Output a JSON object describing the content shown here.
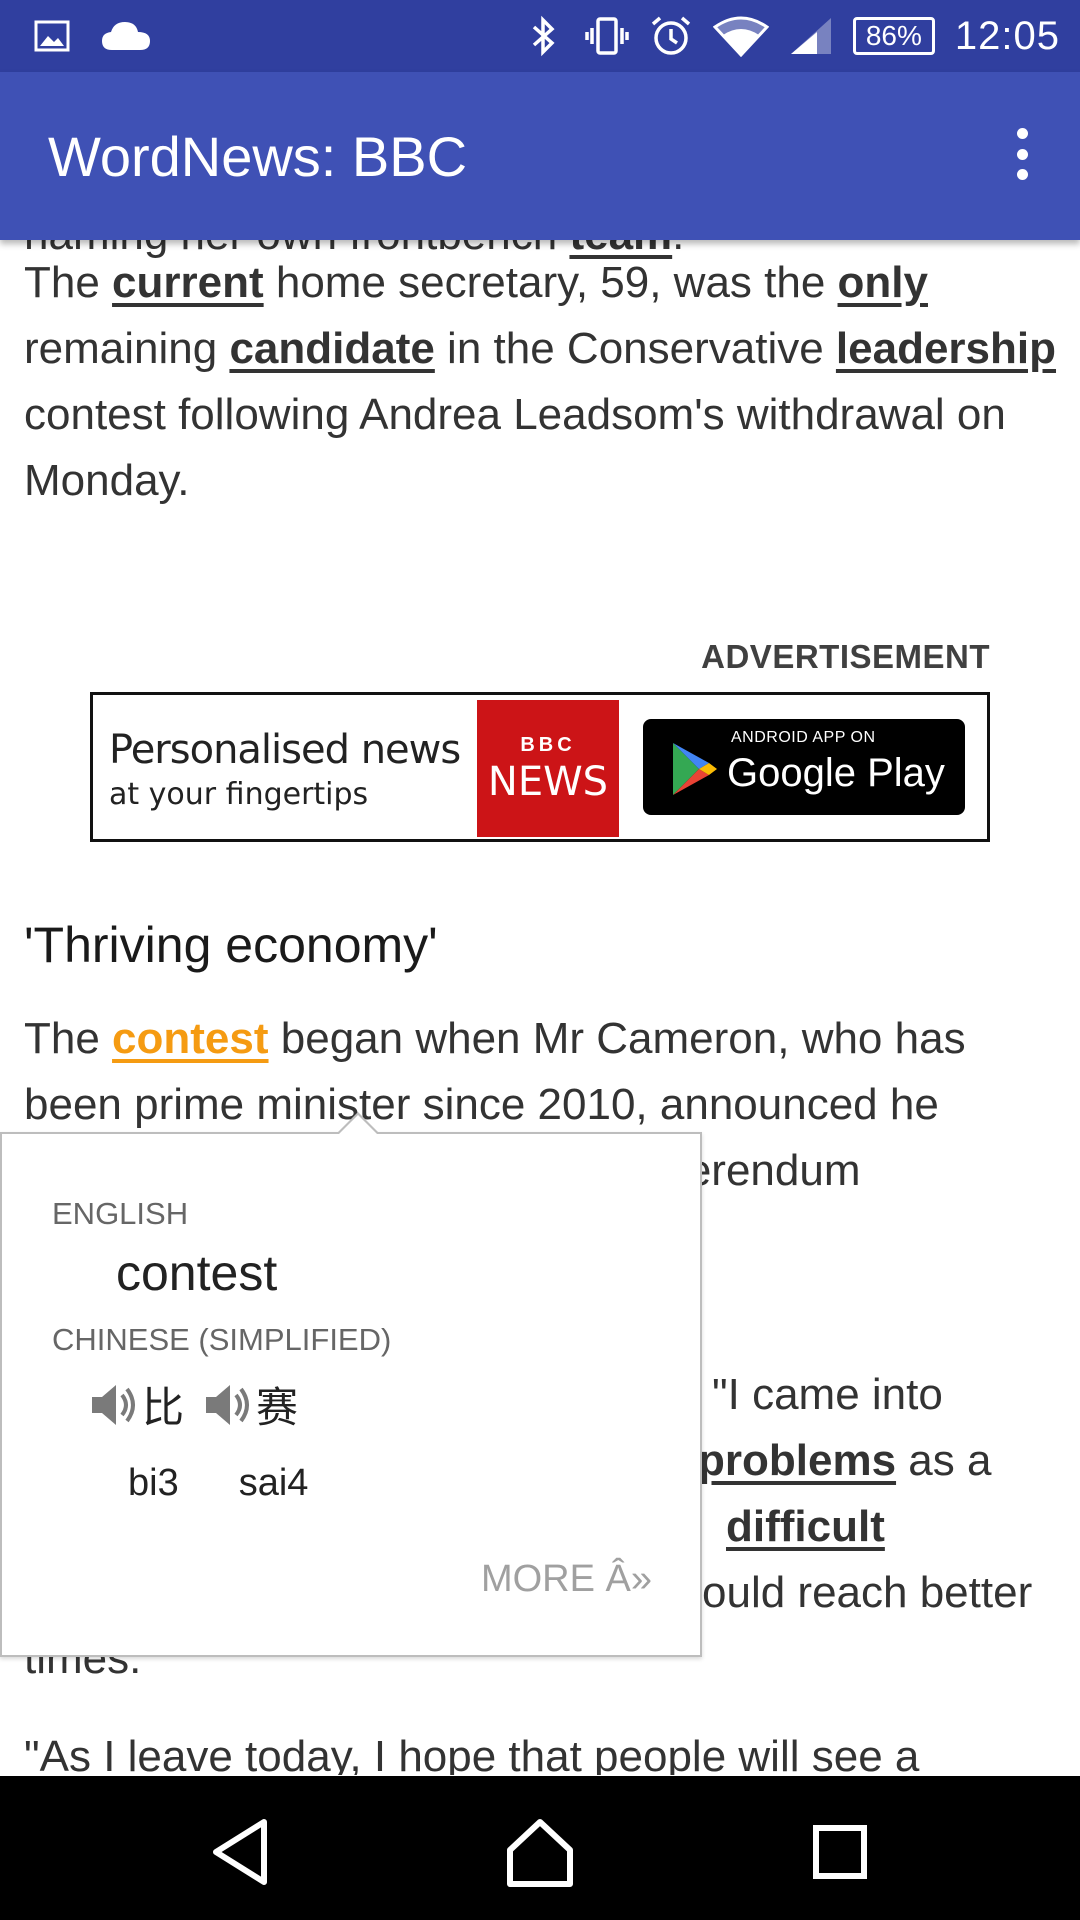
{
  "status_bar": {
    "icons_left": [
      "image-icon",
      "cloud-icon"
    ],
    "icons_right": [
      "bluetooth-icon",
      "vibrate-icon",
      "alarm-icon",
      "wifi-icon",
      "cellular-signal-icon"
    ],
    "battery": "86%",
    "time": "12:05"
  },
  "app_bar": {
    "title": "WordNews: BBC",
    "menu_icon": "overflow-menu-icon"
  },
  "article": {
    "top_cut_line": {
      "pre": "naming her own frontbench ",
      "kw": "team",
      "post": "."
    },
    "p1": {
      "t1": "The ",
      "k1": "current",
      "t2": " home secretary, 59, was the ",
      "k2": "only",
      "t3": " remaining ",
      "k3": "candidate",
      "t4": " in the Conservative ",
      "k4": "leadership",
      "t5": " contest following Andrea Leadsom's withdrawal on Monday."
    },
    "advertisement_label": "ADVERTISEMENT",
    "ad": {
      "headline": "Personalised news",
      "subline": "at your fingertips",
      "bbc_logo": "BBC",
      "bbc_news": "NEWS",
      "store_small": "ANDROID APP ON",
      "store_big": "Google Play"
    },
    "section_heading": "'Thriving economy'",
    "p2": {
      "t1": "The ",
      "k_active": "contest",
      "t2": " began when Mr Cameron, who has been prime minister since 2010, announced he would stand down after the EU referendum"
    },
    "p3": {
      "t1": "\"I came into",
      "k1": "problems",
      "t2": " as a",
      "k2": "difficult",
      "t3": "ould reach better",
      "t4": "times."
    },
    "p4": "\"As I leave today, I hope that people will see a"
  },
  "popup": {
    "source_lang": "ENGLISH",
    "word": "contest",
    "target_lang": "CHINESE (SIMPLIFIED)",
    "characters": [
      "比",
      "赛"
    ],
    "pinyin": [
      "bi3",
      "sai4"
    ],
    "more_label": "MORE Â»"
  },
  "nav_bar": {
    "buttons": [
      "back-icon",
      "home-icon",
      "recents-icon"
    ]
  }
}
